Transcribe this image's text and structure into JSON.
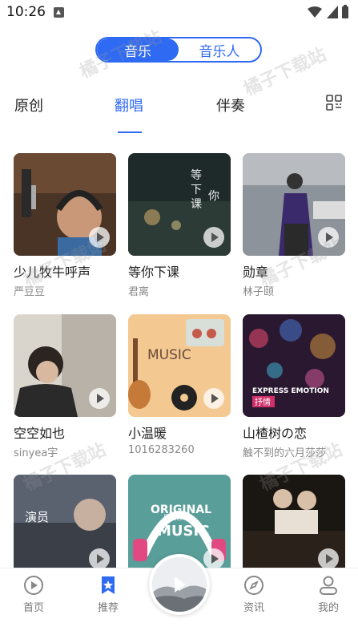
{
  "status": {
    "time": "10:26"
  },
  "toggle": {
    "music": "音乐",
    "musician": "音乐人"
  },
  "tabs": [
    "原创",
    "翻唱",
    "伴奏"
  ],
  "songs": [
    {
      "title": "少儿牧牛呼声",
      "artist": "严豆豆"
    },
    {
      "title": "等你下课",
      "artist": "君离"
    },
    {
      "title": "勋章",
      "artist": "林子颐"
    },
    {
      "title": "空空如也",
      "artist": "sinyea宇"
    },
    {
      "title": "小温暖",
      "artist": "1016283260"
    },
    {
      "title": "山楂树の恋",
      "artist": "触不到的六月莎莎"
    },
    {
      "title": "",
      "artist": ""
    },
    {
      "title": "",
      "artist": ""
    },
    {
      "title": "",
      "artist": ""
    }
  ],
  "cover_text": {
    "c2_a": "等",
    "c2_b": "你",
    "c2_c": "下",
    "c2_d": "课",
    "c5": "MUSIC",
    "c6_a": "EXPRESS EMOTION",
    "c6_b": "抒情",
    "c7": "演员",
    "c8_a": "ORIGINAL",
    "c8_b": "MUSIC",
    "c8_c": "原创音乐"
  },
  "watermark": "橘子下载站",
  "nav": {
    "home": "首页",
    "recommend": "推荐",
    "news": "资讯",
    "mine": "我的"
  },
  "colors": {
    "accent": "#2f6af3"
  }
}
